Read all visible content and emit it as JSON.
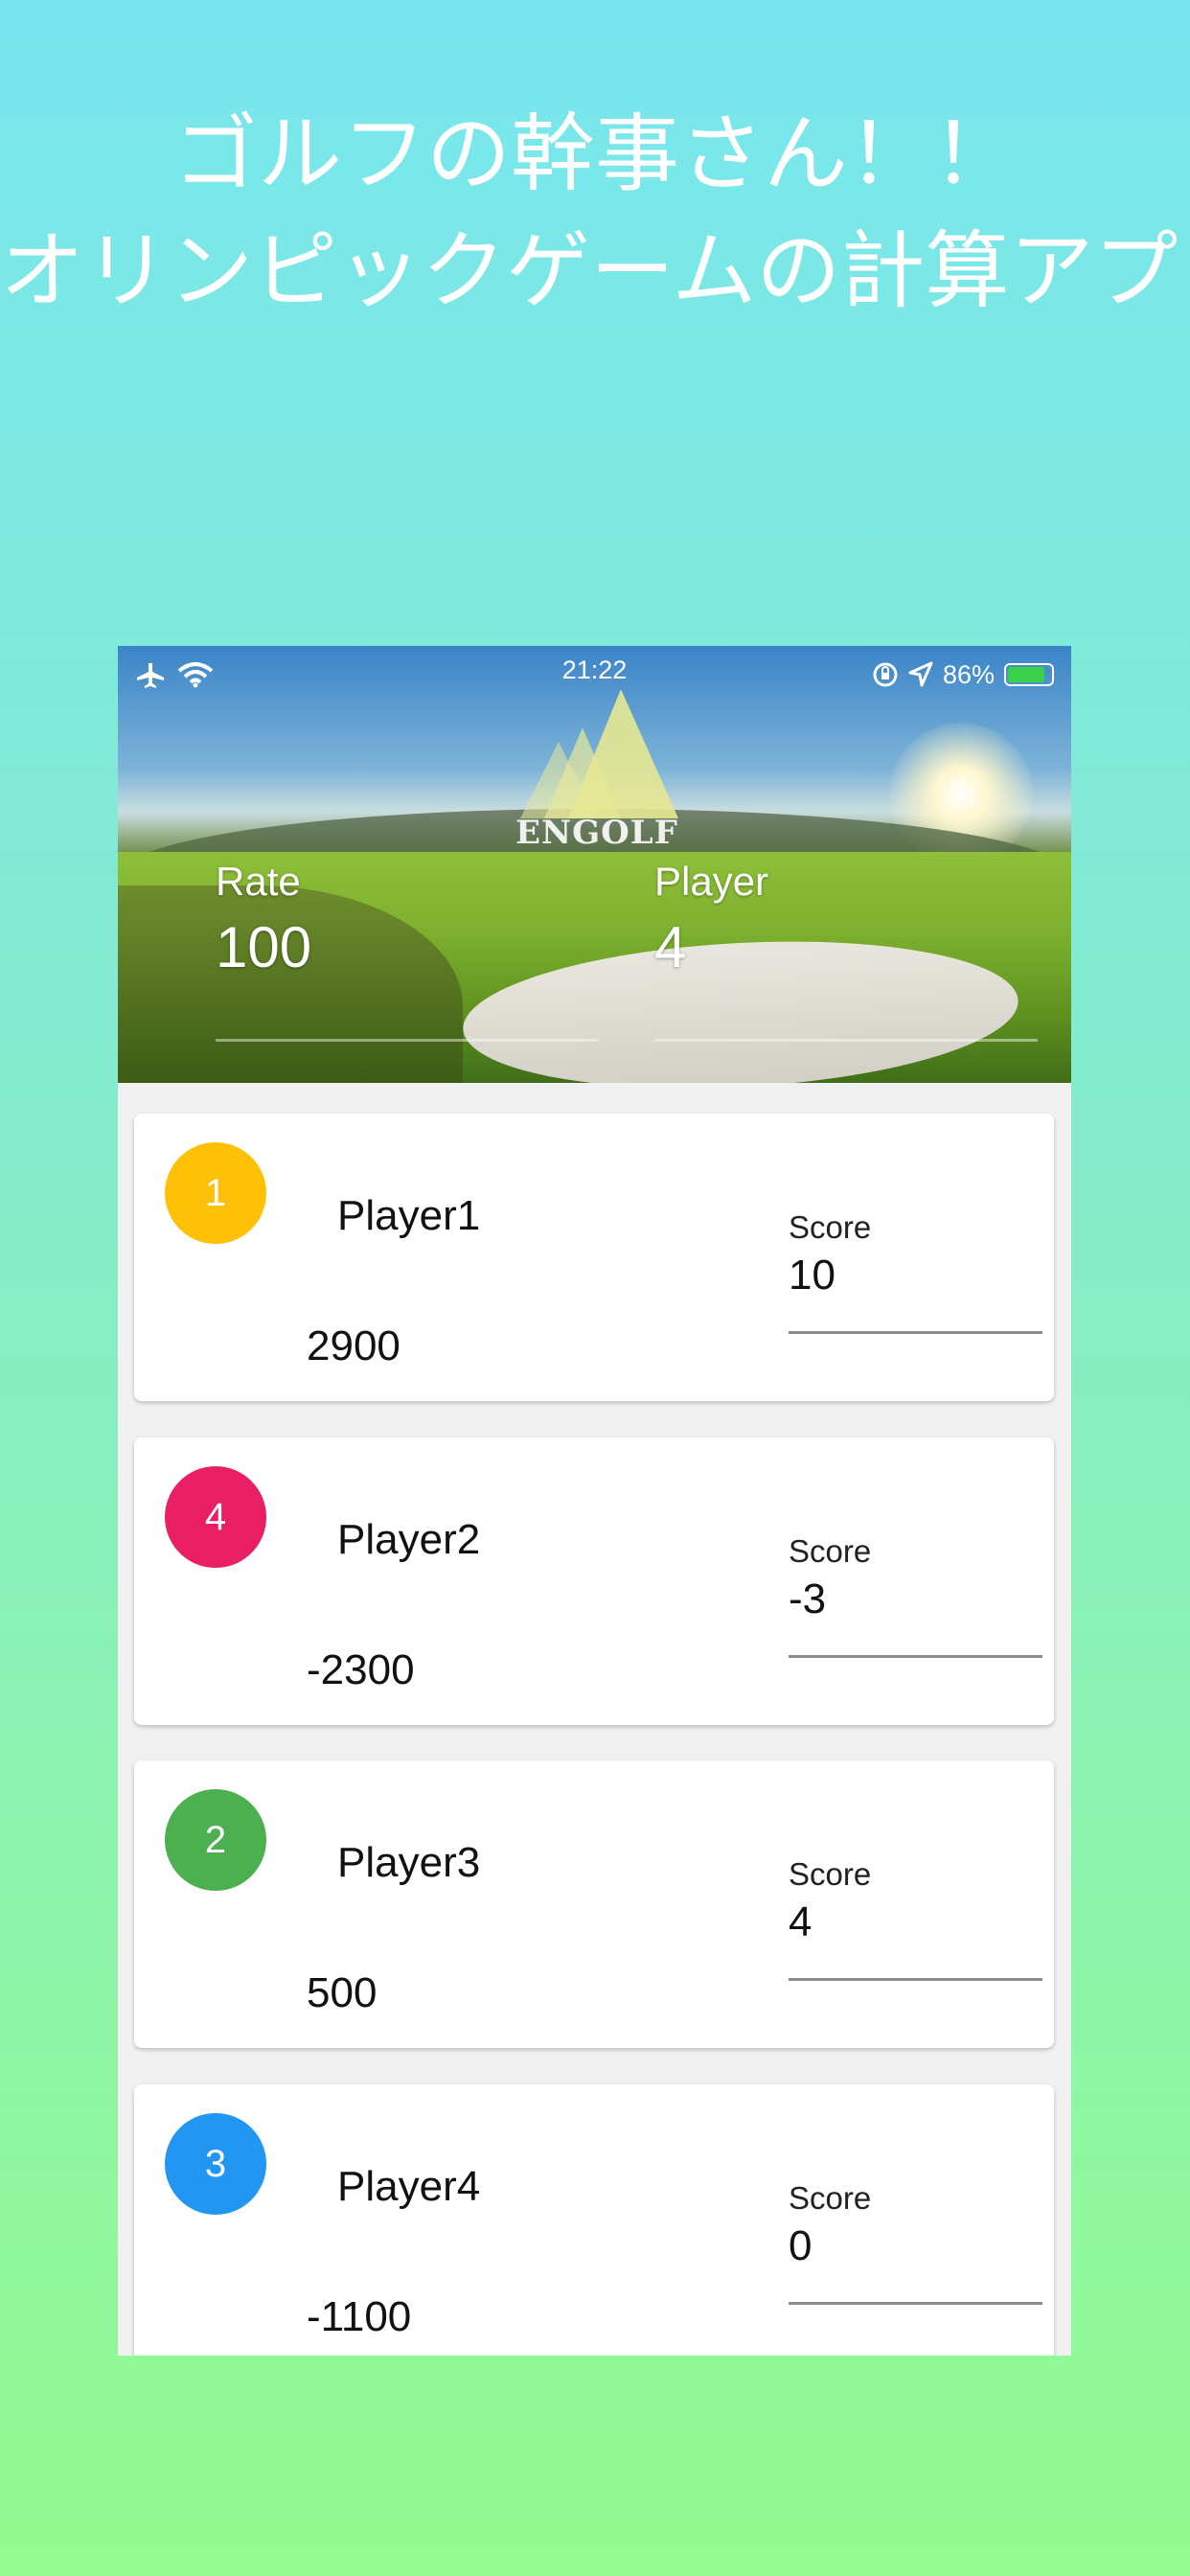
{
  "promo": {
    "line1": "ゴルフの幹事さん！！",
    "line2": "オリンピックゲームの計算アプリ"
  },
  "status_bar": {
    "time": "21:22",
    "battery_percent": "86%",
    "battery_level": 0.86,
    "icons": [
      "airplane-icon",
      "wifi-icon",
      "orientation-lock-icon",
      "location-icon",
      "battery-charging-icon"
    ]
  },
  "header": {
    "logo_text": "ENGOLF",
    "rate_label": "Rate",
    "rate_value": "100",
    "player_label": "Player",
    "player_value": "4"
  },
  "players": [
    {
      "rank": "1",
      "rank_color": "#FFC107",
      "name": "Player1",
      "amount": "2900",
      "score_label": "Score",
      "score": "10"
    },
    {
      "rank": "4",
      "rank_color": "#E91E63",
      "name": "Player2",
      "amount": "-2300",
      "score_label": "Score",
      "score": "-3"
    },
    {
      "rank": "2",
      "rank_color": "#4CAF50",
      "name": "Player3",
      "amount": "500",
      "score_label": "Score",
      "score": "4"
    },
    {
      "rank": "3",
      "rank_color": "#2196F3",
      "name": "Player4",
      "amount": "-1100",
      "score_label": "Score",
      "score": "0"
    }
  ]
}
